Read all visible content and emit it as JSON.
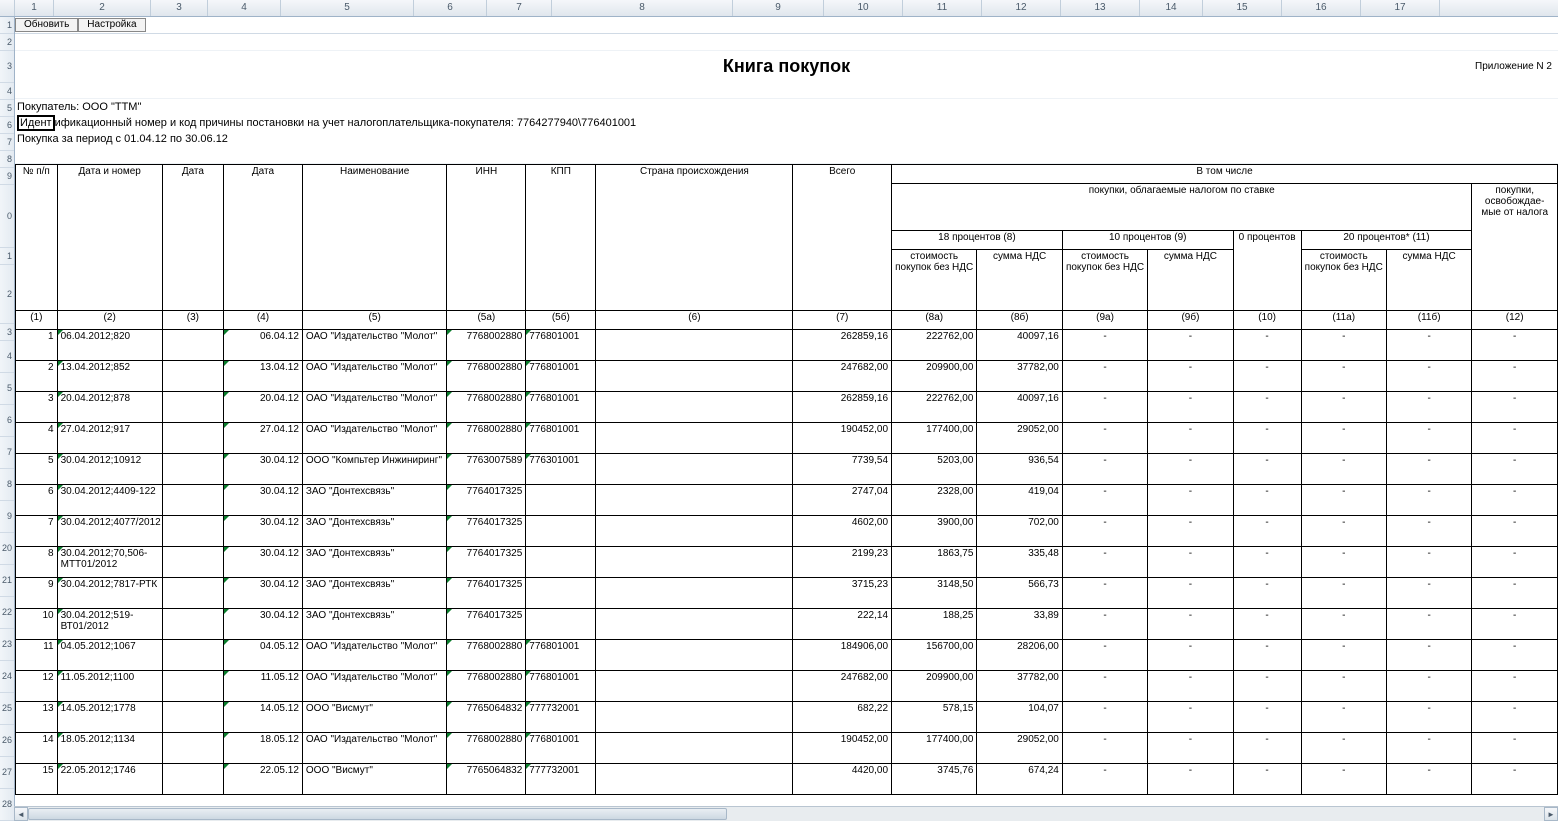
{
  "appendix": "Приложение N 2",
  "title": "Книга покупок",
  "buttons": {
    "refresh": "Обновить",
    "settings": "Настройка"
  },
  "info": {
    "buyer": "Покупатель:  ООО \"ТТМ\"",
    "ident_prefix": "Идент",
    "ident_rest": "ификационный номер и код причины постановки на учет налогоплательщика-покупателя:  7764277940\\776401001",
    "period": "Покупка за период с 01.04.12 по 30.06.12"
  },
  "colhead_widths": [
    38,
    96,
    56,
    72,
    132,
    72,
    64,
    180,
    90,
    78,
    78,
    78,
    78,
    62,
    78,
    78,
    78
  ],
  "headers": {
    "h1": [
      "№ п/п",
      "Дата и номер",
      "Дата",
      "Дата",
      "Наименование",
      "ИНН",
      "КПП",
      "Страна происхождения",
      "Всего",
      "В том числе"
    ],
    "h2_taxed": "покупки, облагаемые налогом по ставке",
    "h2_exempt": "покупки, освобождае-мые от налога",
    "rate18": "18 процентов (8)",
    "rate10": "10 процентов (9)",
    "rate0": "0 процентов",
    "rate20": "20 процентов* (11)",
    "sub_cost": "стоимость покупок без НДС",
    "sub_vat": "сумма НДС",
    "nums": [
      "(1)",
      "(2)",
      "(3)",
      "(4)",
      "(5)",
      "(5а)",
      "(5б)",
      "(6)",
      "(7)",
      "(8а)",
      "(8б)",
      "(9а)",
      "(9б)",
      "(10)",
      "(11а)",
      "(11б)",
      "(12)"
    ]
  },
  "rows": [
    {
      "n": "1",
      "dn": "06.04.2012;820",
      "d3": "",
      "d4": "06.04.12",
      "name": "ОАО \"Издательство \"Молот\"",
      "inn": "7768002880",
      "kpp": "776801001",
      "orig": "",
      "tot": "262859,16",
      "c8a": "222762,00",
      "c8b": "40097,16",
      "c9a": "-",
      "c9b": "-",
      "c10": "-",
      "c11a": "-",
      "c11b": "-",
      "c12": "-"
    },
    {
      "n": "2",
      "dn": "13.04.2012;852",
      "d3": "",
      "d4": "13.04.12",
      "name": "ОАО \"Издательство \"Молот\"",
      "inn": "7768002880",
      "kpp": "776801001",
      "orig": "",
      "tot": "247682,00",
      "c8a": "209900,00",
      "c8b": "37782,00",
      "c9a": "-",
      "c9b": "-",
      "c10": "-",
      "c11a": "-",
      "c11b": "-",
      "c12": "-"
    },
    {
      "n": "3",
      "dn": "20.04.2012;878",
      "d3": "",
      "d4": "20.04.12",
      "name": "ОАО \"Издательство \"Молот\"",
      "inn": "7768002880",
      "kpp": "776801001",
      "orig": "",
      "tot": "262859,16",
      "c8a": "222762,00",
      "c8b": "40097,16",
      "c9a": "-",
      "c9b": "-",
      "c10": "-",
      "c11a": "-",
      "c11b": "-",
      "c12": "-"
    },
    {
      "n": "4",
      "dn": "27.04.2012;917",
      "d3": "",
      "d4": "27.04.12",
      "name": "ОАО \"Издательство \"Молот\"",
      "inn": "7768002880",
      "kpp": "776801001",
      "orig": "",
      "tot": "190452,00",
      "c8a": "177400,00",
      "c8b": "29052,00",
      "c9a": "-",
      "c9b": "-",
      "c10": "-",
      "c11a": "-",
      "c11b": "-",
      "c12": "-"
    },
    {
      "n": "5",
      "dn": "30.04.2012;10912",
      "d3": "",
      "d4": "30.04.12",
      "name": "ООО \"Компьтер Инжиниринг\"",
      "inn": "7763007589",
      "kpp": "776301001",
      "orig": "",
      "tot": "7739,54",
      "c8a": "5203,00",
      "c8b": "936,54",
      "c9a": "-",
      "c9b": "-",
      "c10": "-",
      "c11a": "-",
      "c11b": "-",
      "c12": "-"
    },
    {
      "n": "6",
      "dn": "30.04.2012;4409-122",
      "d3": "",
      "d4": "30.04.12",
      "name": "ЗАО \"Донтехсвязь\"",
      "inn": "7764017325",
      "kpp": "",
      "orig": "",
      "tot": "2747,04",
      "c8a": "2328,00",
      "c8b": "419,04",
      "c9a": "-",
      "c9b": "-",
      "c10": "-",
      "c11a": "-",
      "c11b": "-",
      "c12": "-"
    },
    {
      "n": "7",
      "dn": "30.04.2012;4077/2012",
      "d3": "",
      "d4": "30.04.12",
      "name": "ЗАО \"Донтехсвязь\"",
      "inn": "7764017325",
      "kpp": "",
      "orig": "",
      "tot": "4602,00",
      "c8a": "3900,00",
      "c8b": "702,00",
      "c9a": "-",
      "c9b": "-",
      "c10": "-",
      "c11a": "-",
      "c11b": "-",
      "c12": "-"
    },
    {
      "n": "8",
      "dn": "30.04.2012;70,506-МТТ01/2012",
      "d3": "",
      "d4": "30.04.12",
      "name": "ЗАО \"Донтехсвязь\"",
      "inn": "7764017325",
      "kpp": "",
      "orig": "",
      "tot": "2199,23",
      "c8a": "1863,75",
      "c8b": "335,48",
      "c9a": "-",
      "c9b": "-",
      "c10": "-",
      "c11a": "-",
      "c11b": "-",
      "c12": "-"
    },
    {
      "n": "9",
      "dn": "30.04.2012;7817-РТК",
      "d3": "",
      "d4": "30.04.12",
      "name": "ЗАО \"Донтехсвязь\"",
      "inn": "7764017325",
      "kpp": "",
      "orig": "",
      "tot": "3715,23",
      "c8a": "3148,50",
      "c8b": "566,73",
      "c9a": "-",
      "c9b": "-",
      "c10": "-",
      "c11a": "-",
      "c11b": "-",
      "c12": "-"
    },
    {
      "n": "10",
      "dn": "30.04.2012;519-ВТ01/2012",
      "d3": "",
      "d4": "30.04.12",
      "name": "ЗАО \"Донтехсвязь\"",
      "inn": "7764017325",
      "kpp": "",
      "orig": "",
      "tot": "222,14",
      "c8a": "188,25",
      "c8b": "33,89",
      "c9a": "-",
      "c9b": "-",
      "c10": "-",
      "c11a": "-",
      "c11b": "-",
      "c12": "-"
    },
    {
      "n": "11",
      "dn": "04.05.2012;1067",
      "d3": "",
      "d4": "04.05.12",
      "name": "ОАО \"Издательство \"Молот\"",
      "inn": "7768002880",
      "kpp": "776801001",
      "orig": "",
      "tot": "184906,00",
      "c8a": "156700,00",
      "c8b": "28206,00",
      "c9a": "-",
      "c9b": "-",
      "c10": "-",
      "c11a": "-",
      "c11b": "-",
      "c12": "-"
    },
    {
      "n": "12",
      "dn": "11.05.2012;1100",
      "d3": "",
      "d4": "11.05.12",
      "name": "ОАО \"Издательство \"Молот\"",
      "inn": "7768002880",
      "kpp": "776801001",
      "orig": "",
      "tot": "247682,00",
      "c8a": "209900,00",
      "c8b": "37782,00",
      "c9a": "-",
      "c9b": "-",
      "c10": "-",
      "c11a": "-",
      "c11b": "-",
      "c12": "-"
    },
    {
      "n": "13",
      "dn": "14.05.2012;1778",
      "d3": "",
      "d4": "14.05.12",
      "name": "ООО \"Висмут\"",
      "inn": "7765064832",
      "kpp": "777732001",
      "orig": "",
      "tot": "682,22",
      "c8a": "578,15",
      "c8b": "104,07",
      "c9a": "-",
      "c9b": "-",
      "c10": "-",
      "c11a": "-",
      "c11b": "-",
      "c12": "-"
    },
    {
      "n": "14",
      "dn": "18.05.2012;1134",
      "d3": "",
      "d4": "18.05.12",
      "name": "ОАО \"Издательство \"Молот\"",
      "inn": "7768002880",
      "kpp": "776801001",
      "orig": "",
      "tot": "190452,00",
      "c8a": "177400,00",
      "c8b": "29052,00",
      "c9a": "-",
      "c9b": "-",
      "c10": "-",
      "c11a": "-",
      "c11b": "-",
      "c12": "-"
    },
    {
      "n": "15",
      "dn": "22.05.2012;1746",
      "d3": "",
      "d4": "22.05.12",
      "name": "ООО \"Висмут\"",
      "inn": "7765064832",
      "kpp": "777732001",
      "orig": "",
      "tot": "4420,00",
      "c8a": "3745,76",
      "c8b": "674,24",
      "c9a": "-",
      "c9b": "-",
      "c10": "-",
      "c11a": "-",
      "c11b": "-",
      "c12": "-"
    }
  ],
  "rownums_left": [
    "1",
    "2",
    "3",
    "4",
    "5",
    "6",
    "7",
    "8",
    "9",
    "0",
    "1",
    "2",
    "3",
    "4",
    "5",
    "6",
    "7",
    "8",
    "9",
    "20",
    "21",
    "22",
    "23",
    "24",
    "25",
    "26",
    "27",
    "28"
  ]
}
